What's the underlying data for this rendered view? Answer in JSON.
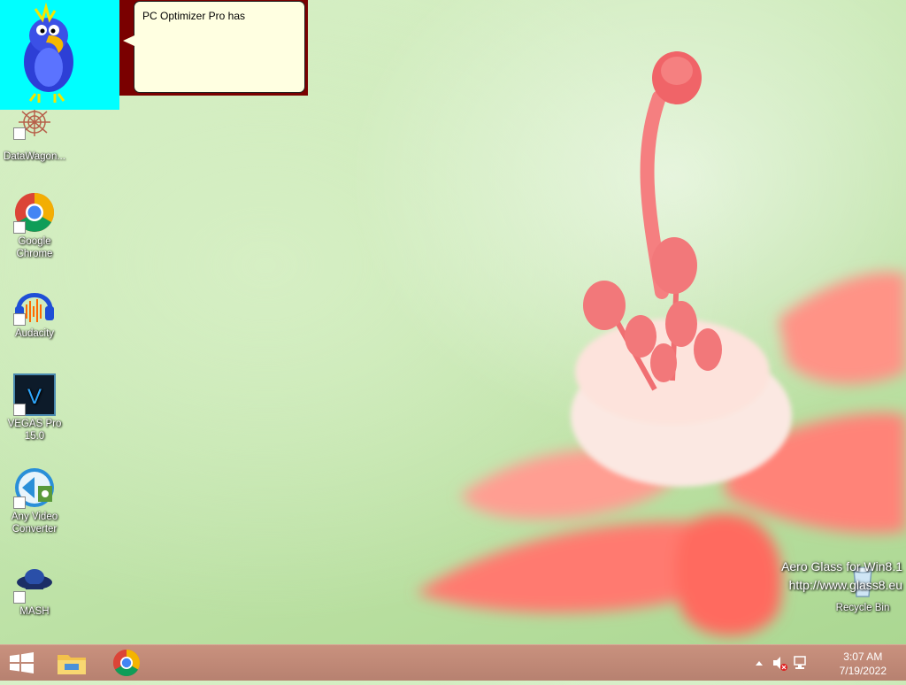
{
  "assistant": {
    "icon": "parrot-assistant-icon",
    "message": "PC Optimizer Pro has"
  },
  "desktop_icons": [
    {
      "label": "DataWagon...",
      "icon": "datawagon-icon"
    },
    {
      "label": "Google Chrome",
      "icon": "chrome-icon"
    },
    {
      "label": "Audacity",
      "icon": "audacity-icon"
    },
    {
      "label": "VEGAS Pro 15.0",
      "icon": "vegas-pro-icon"
    },
    {
      "label": "Any Video Converter",
      "icon": "any-video-converter-icon"
    },
    {
      "label": "MASH",
      "icon": "mash-icon"
    },
    {
      "label": "Recycle Bin",
      "icon": "recycle-bin-icon"
    }
  ],
  "watermark": {
    "line1": "Aero Glass for Win8.1",
    "line2": "http://www.glass8.eu"
  },
  "taskbar": {
    "start": "windows-start-icon",
    "pinned": [
      "file-explorer-icon",
      "chrome-icon"
    ],
    "tray_icons": [
      "show-hidden-icons-icon",
      "volume-muted-icon",
      "network-icon"
    ],
    "time": "3:07 AM",
    "date": "7/19/2022"
  },
  "colors": {
    "assistant_bg": "#00ffff",
    "balloon_bg": "#ffffe1",
    "taskbar": "#c08978"
  }
}
